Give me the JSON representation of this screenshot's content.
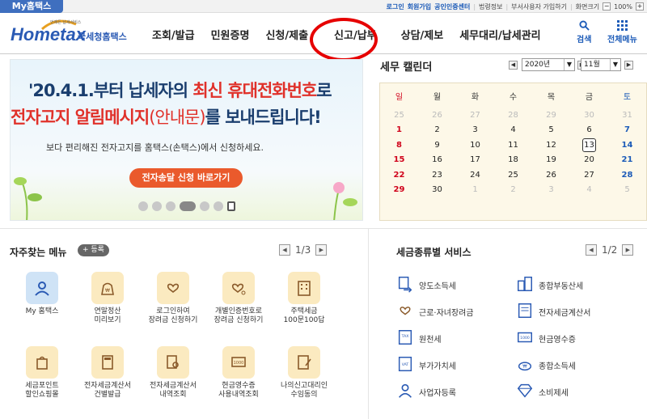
{
  "topbar": {
    "myhome": "My홈택스",
    "links": [
      "로그인",
      "회원가입",
      "공인인증센터",
      "법령정보",
      "부서사용자 가입하기",
      "화면크기"
    ],
    "zoom": "100%"
  },
  "header": {
    "logo_sub": "언제든 납세서비스",
    "logo_main": "Hometax",
    "logo_kor": "국세청홈택스",
    "nav": [
      "조회/발급",
      "민원증명",
      "신청/제출",
      "신고/납부",
      "상담/제보",
      "세무대리/납세관리"
    ],
    "search_label": "검색",
    "allmenu_label": "전체메뉴"
  },
  "banner": {
    "line1_a": "'20.4.1.부터 납세자의 ",
    "line1_hl": "최신 휴대전화번호",
    "line1_b": "로",
    "line2_hl": "전자고지 알림메시지",
    "line2_paren": "(안내문)",
    "line2_b": "를 보내드립니다!",
    "subtext": "보다 편리해진 전자고지를 홈택스(손택스)에서 신청하세요.",
    "button": "전자송달 신청 바로가기"
  },
  "calendar": {
    "title": "세무 캘린더",
    "year": "2020년",
    "month": "11월",
    "weekdays": [
      "일",
      "월",
      "화",
      "수",
      "목",
      "금",
      "토"
    ],
    "today": "13",
    "days": [
      [
        "25",
        "26",
        "27",
        "28",
        "29",
        "30",
        "31"
      ],
      [
        "1",
        "2",
        "3",
        "4",
        "5",
        "6",
        "7"
      ],
      [
        "8",
        "9",
        "10",
        "11",
        "12",
        "13",
        "14"
      ],
      [
        "15",
        "16",
        "17",
        "18",
        "19",
        "20",
        "21"
      ],
      [
        "22",
        "23",
        "24",
        "25",
        "26",
        "27",
        "28"
      ],
      [
        "29",
        "30",
        "1",
        "2",
        "3",
        "4",
        "5"
      ]
    ],
    "other_month": [
      [
        0,
        0
      ],
      [
        0,
        1
      ],
      [
        0,
        2
      ],
      [
        0,
        3
      ],
      [
        0,
        4
      ],
      [
        0,
        5
      ],
      [
        0,
        6
      ],
      [
        5,
        2
      ],
      [
        5,
        3
      ],
      [
        5,
        4
      ],
      [
        5,
        5
      ],
      [
        5,
        6
      ]
    ]
  },
  "favorites": {
    "title": "자주찾는 메뉴",
    "add_label": "등록",
    "page": "1/3",
    "items": [
      {
        "l1": "My 홈택스",
        "l2": "",
        "icon": "user-icon"
      },
      {
        "l1": "연말정산",
        "l2": "미리보기",
        "icon": "money-bag-icon"
      },
      {
        "l1": "로그인하여",
        "l2": "장려금 신청하기",
        "icon": "heart-hand-icon"
      },
      {
        "l1": "개별인증번호로",
        "l2": "장려금 신청하기",
        "icon": "heart-key-icon"
      },
      {
        "l1": "주택세금",
        "l2": "100문100답",
        "icon": "building-icon"
      },
      {
        "l1": "세금포인트",
        "l2": "할인쇼핑몰",
        "icon": "shopping-bag-icon"
      },
      {
        "l1": "전자세금계산서",
        "l2": "건별발급",
        "icon": "calculator-icon"
      },
      {
        "l1": "전자세금계산서",
        "l2": "내역조회",
        "icon": "search-doc-icon"
      },
      {
        "l1": "현금영수증",
        "l2": "사용내역조회",
        "icon": "receipt-search-icon"
      },
      {
        "l1": "나의신고대리인",
        "l2": "수임동의",
        "icon": "sign-doc-icon"
      }
    ]
  },
  "services": {
    "title": "세금종류별 서비스",
    "page": "1/2",
    "items": [
      {
        "label": "양도소득세",
        "icon": "transfer-doc-icon"
      },
      {
        "label": "종합부동산세",
        "icon": "buildings-icon"
      },
      {
        "label": "근로·자녀장려금",
        "icon": "heart-hand-icon"
      },
      {
        "label": "전자세금계산서",
        "icon": "invoice-icon"
      },
      {
        "label": "원천세",
        "icon": "tax-doc-icon"
      },
      {
        "label": "현금영수증",
        "icon": "receipt-icon"
      },
      {
        "label": "부가가치세",
        "icon": "vat-icon"
      },
      {
        "label": "종합소득세",
        "icon": "coin-bag-icon"
      },
      {
        "label": "사업자등록",
        "icon": "person-icon"
      },
      {
        "label": "소비제세",
        "icon": "diamond-icon"
      }
    ]
  },
  "colors": {
    "brand": "#2a5ab4",
    "accent": "#ea5a2c",
    "highlight": "#e0312a",
    "annotation": "#e60000"
  }
}
